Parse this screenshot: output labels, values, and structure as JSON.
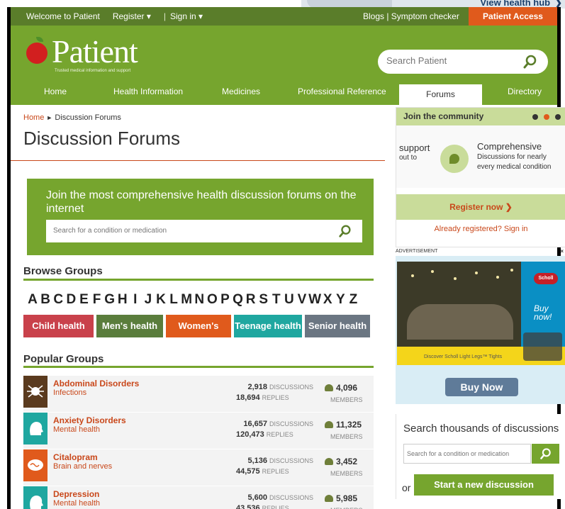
{
  "outside_window": {
    "link_text": "View health hub",
    "chevron": "❯"
  },
  "topbar": {
    "welcome": "Welcome to Patient",
    "register": "Register ▾",
    "separator": "|",
    "sign_in": "Sign in ▾",
    "blogs": "Blogs | Symptom checker",
    "patient_access": "Patient Access"
  },
  "header": {
    "logo_text": "Patient",
    "tagline": "Trusted medical information and support",
    "search_placeholder": "Search Patient"
  },
  "nav": {
    "items": [
      "Home",
      "Health Information",
      "Medicines",
      "Professional Reference",
      "Forums",
      "Directory"
    ],
    "active": "Forums"
  },
  "breadcrumb": {
    "home": "Home",
    "arrow": "►",
    "current": "Discussion Forums"
  },
  "page_title": "Discussion Forums",
  "join_box": {
    "text": "Join the most comprehensive health discussion forums on the internet",
    "search_placeholder": "Search for a condition or medication"
  },
  "browse": {
    "heading": "Browse Groups",
    "letters": [
      "A",
      "B",
      "C",
      "D",
      "E",
      "F",
      "G",
      "H",
      "I",
      "J",
      "K",
      "L",
      "M",
      "N",
      "O",
      "P",
      "Q",
      "R",
      "S",
      "T",
      "U",
      "V",
      "W",
      "X",
      "Y",
      "Z"
    ],
    "categories": [
      {
        "label": "Child health",
        "color": "#c9414b"
      },
      {
        "label": "Men's health",
        "color": "#5a7d3c"
      },
      {
        "label": "Women's",
        "color": "#e05a1c"
      },
      {
        "label": "Teenage health",
        "color": "#1fa7a0"
      },
      {
        "label": "Senior health",
        "color": "#6b7682"
      }
    ]
  },
  "popular": {
    "heading": "Popular Groups",
    "discussions_label": "DISCUSSIONS",
    "replies_label": "REPLIES",
    "members_label": "MEMBERS",
    "groups": [
      {
        "name": "Abdominal Disorders",
        "category": "Infections",
        "discussions": "2,918",
        "replies": "18,694",
        "members": "4,096",
        "badge_color": "#5a3a1e",
        "icon": "bug-icon"
      },
      {
        "name": "Anxiety Disorders",
        "category": "Mental health",
        "discussions": "16,657",
        "replies": "120,473",
        "members": "11,325",
        "badge_color": "#1fa7a0",
        "icon": "head-icon"
      },
      {
        "name": "Citalopram",
        "category": "Brain and nerves",
        "discussions": "5,136",
        "replies": "44,575",
        "members": "3,452",
        "badge_color": "#e05a1c",
        "icon": "brain-icon"
      },
      {
        "name": "Depression",
        "category": "Mental health",
        "discussions": "5,600",
        "replies": "43,536",
        "members": "5,985",
        "badge_color": "#1fa7a0",
        "icon": "head-icon"
      }
    ]
  },
  "community": {
    "heading": "Join the community",
    "slide_left_title": "support",
    "slide_left_sub": "out to",
    "slide_right_title": "Comprehensive",
    "slide_right_sub": "Discussions for nearly every medical condition",
    "register": "Register now  ❯",
    "signin": "Already registered? Sign in",
    "dot_colors": [
      "#333333",
      "#e05a1c",
      "#333333"
    ]
  },
  "ad": {
    "label": "ADVERTISEMENT",
    "close": "×",
    "brand": "Scholl",
    "cta_small": "Buy now!",
    "strip_text": "Discover Scholl Light Legs™ Tights",
    "button": "Buy Now"
  },
  "search_discussions": {
    "heading": "Search thousands of discussions",
    "placeholder": "Search for a condition or medication",
    "or": "or",
    "start": "Start a new discussion"
  },
  "colors": {
    "brand_green": "#76a52e",
    "dark_green": "#5a7d2a",
    "accent_orange": "#e05a1c",
    "link_red": "#c9481b"
  }
}
